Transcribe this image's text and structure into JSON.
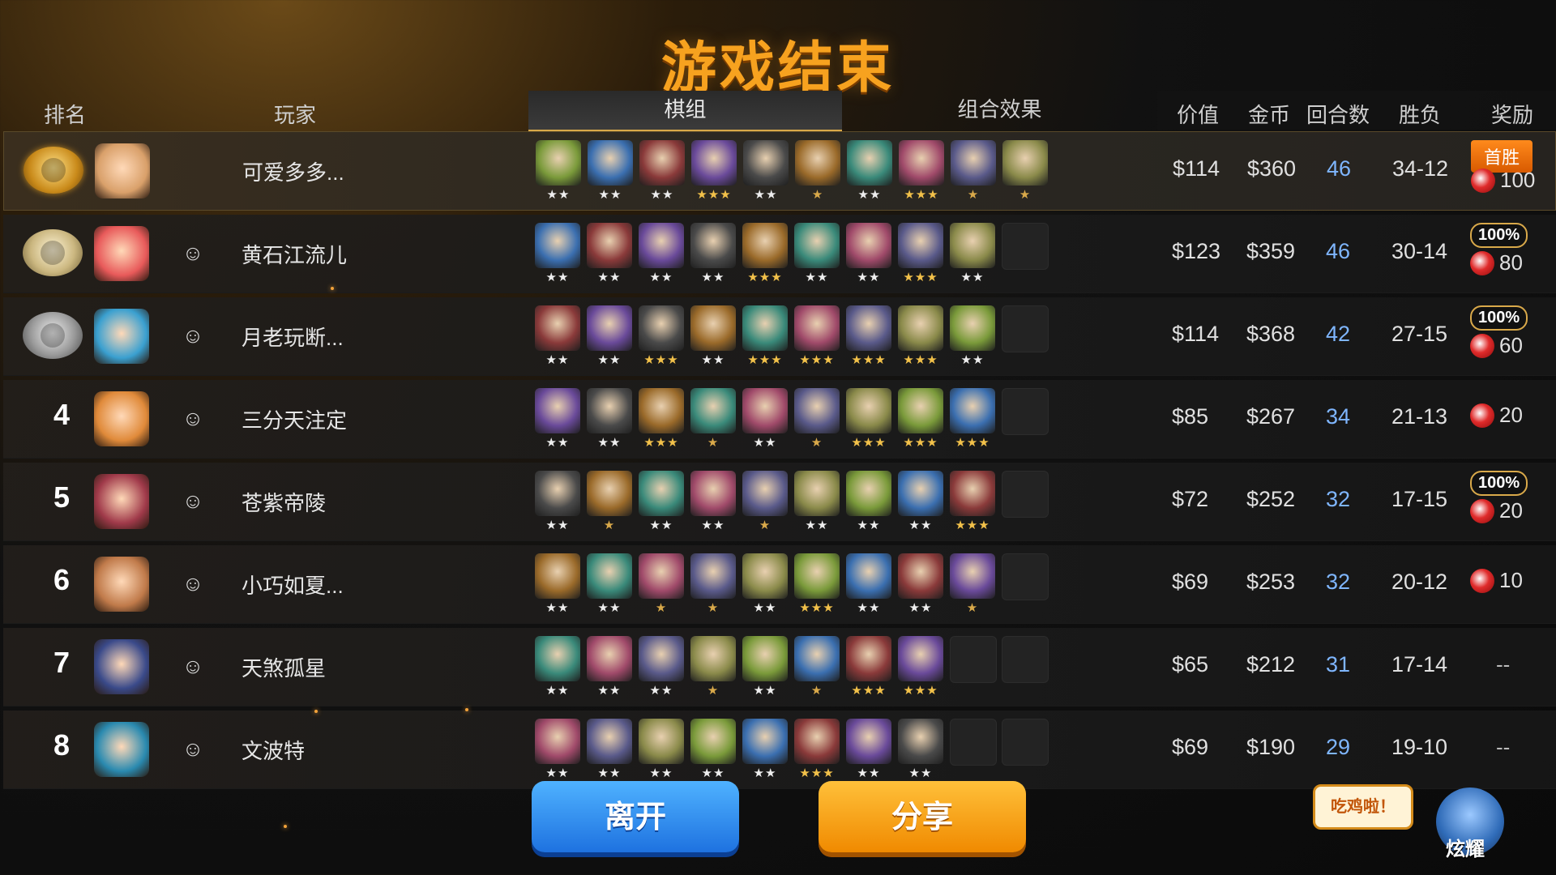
{
  "title": "游戏结束",
  "columns": {
    "rank": "排名",
    "player": "玩家",
    "lineup": "棋组",
    "synergy": "组合效果",
    "value": "价值",
    "gold": "金币",
    "rounds": "回合数",
    "win_loss": "胜负",
    "reward": "奖励"
  },
  "players": [
    {
      "rank": "1",
      "name": "可爱多多...",
      "value": "$114",
      "gold": "$360",
      "rounds": "46",
      "wl": "34-12",
      "reward_tag": "首胜",
      "reward_amount": "100",
      "reward_pct": "",
      "units": [
        2,
        2,
        2,
        3,
        2,
        1,
        2,
        3,
        1,
        1
      ]
    },
    {
      "rank": "2",
      "name": "黄石江流儿",
      "value": "$123",
      "gold": "$359",
      "rounds": "46",
      "wl": "30-14",
      "reward_tag": "",
      "reward_amount": "80",
      "reward_pct": "100%",
      "units": [
        2,
        2,
        2,
        2,
        3,
        2,
        2,
        3,
        2,
        0
      ]
    },
    {
      "rank": "3",
      "name": "月老玩断...",
      "value": "$114",
      "gold": "$368",
      "rounds": "42",
      "wl": "27-15",
      "reward_tag": "",
      "reward_amount": "60",
      "reward_pct": "100%",
      "units": [
        2,
        2,
        3,
        2,
        3,
        3,
        3,
        3,
        2,
        0
      ]
    },
    {
      "rank": "4",
      "name": "三分天注定",
      "value": "$85",
      "gold": "$267",
      "rounds": "34",
      "wl": "21-13",
      "reward_tag": "",
      "reward_amount": "20",
      "reward_pct": "",
      "units": [
        2,
        2,
        3,
        1,
        2,
        1,
        3,
        3,
        3,
        0
      ]
    },
    {
      "rank": "5",
      "name": "苍紫帝陵",
      "value": "$72",
      "gold": "$252",
      "rounds": "32",
      "wl": "17-15",
      "reward_tag": "",
      "reward_amount": "20",
      "reward_pct": "100%",
      "units": [
        2,
        1,
        2,
        2,
        1,
        2,
        2,
        2,
        3,
        0
      ]
    },
    {
      "rank": "6",
      "name": "小巧如夏...",
      "value": "$69",
      "gold": "$253",
      "rounds": "32",
      "wl": "20-12",
      "reward_tag": "",
      "reward_amount": "10",
      "reward_pct": "",
      "units": [
        2,
        2,
        1,
        1,
        2,
        3,
        2,
        2,
        1,
        0
      ]
    },
    {
      "rank": "7",
      "name": "天煞孤星",
      "value": "$65",
      "gold": "$212",
      "rounds": "31",
      "wl": "17-14",
      "reward_tag": "",
      "reward_amount": "--",
      "reward_pct": "",
      "units": [
        2,
        2,
        2,
        1,
        2,
        1,
        3,
        3,
        0,
        0
      ]
    },
    {
      "rank": "8",
      "name": "文波特",
      "value": "$69",
      "gold": "$190",
      "rounds": "29",
      "wl": "19-10",
      "reward_tag": "",
      "reward_amount": "--",
      "reward_pct": "",
      "units": [
        2,
        2,
        2,
        2,
        2,
        3,
        2,
        2,
        0,
        0
      ]
    }
  ],
  "buttons": {
    "leave": "离开",
    "share": "分享"
  },
  "mascot": {
    "bubble": "吃鸡啦！",
    "label": "炫耀"
  },
  "colors": {
    "accent": "#f7a21f",
    "leave": "#2b8cf0",
    "share": "#f7a21f",
    "rounds": "#7fb6ff",
    "star": "#f2c14a"
  },
  "icons": {
    "add_friend": "add-friend-icon",
    "reward": "candy-icon"
  }
}
